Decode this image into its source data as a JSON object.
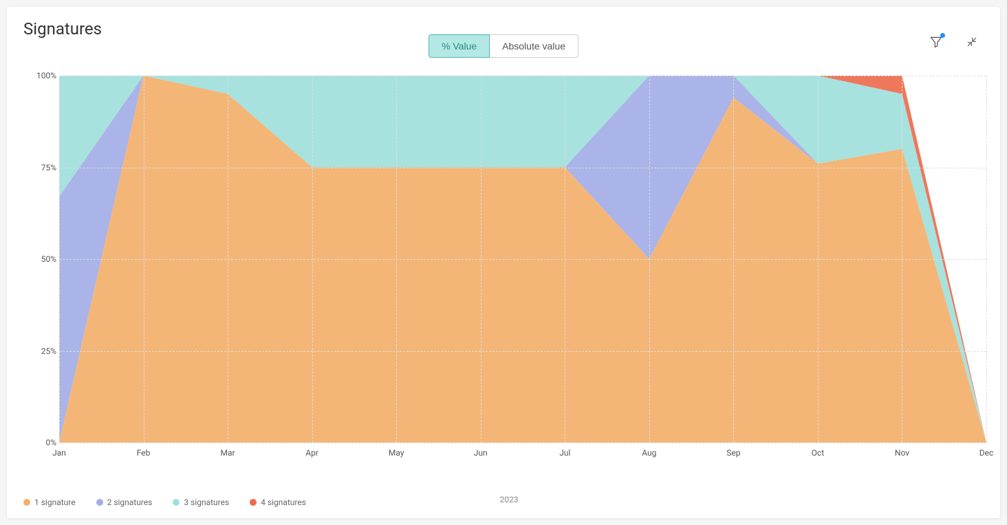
{
  "title": "Signatures",
  "toggle": {
    "percent": "% Value",
    "absolute": "Absolute value",
    "active": "percent"
  },
  "chart_data": {
    "type": "area",
    "stacked": true,
    "normalized_percent": true,
    "categories": [
      "Jan",
      "Feb",
      "Mar",
      "Apr",
      "May",
      "Jun",
      "Jul",
      "Aug",
      "Sep",
      "Oct",
      "Nov",
      "Dec"
    ],
    "x_axis_sublabel": "2023",
    "ylabel": "",
    "ytick_labels": [
      "0%",
      "25%",
      "50%",
      "75%",
      "100%"
    ],
    "ylim": [
      0,
      100
    ],
    "series": [
      {
        "name": "1 signature",
        "color": "#f3b06b",
        "values": [
          0,
          100,
          95,
          75,
          75,
          75,
          75,
          50,
          94,
          76,
          80,
          0
        ]
      },
      {
        "name": "2 signatures",
        "color": "#a4aee6",
        "values": [
          67,
          0,
          0,
          0,
          0,
          0,
          0,
          50,
          6,
          0,
          0,
          0
        ]
      },
      {
        "name": "3 signatures",
        "color": "#9fe0dc",
        "values": [
          33,
          0,
          5,
          25,
          25,
          25,
          25,
          0,
          0,
          24,
          15,
          0
        ]
      },
      {
        "name": "4 signatures",
        "color": "#ee6b4d",
        "values": [
          0,
          0,
          0,
          0,
          0,
          0,
          0,
          0,
          0,
          0,
          5,
          0
        ]
      }
    ],
    "annotations": []
  }
}
